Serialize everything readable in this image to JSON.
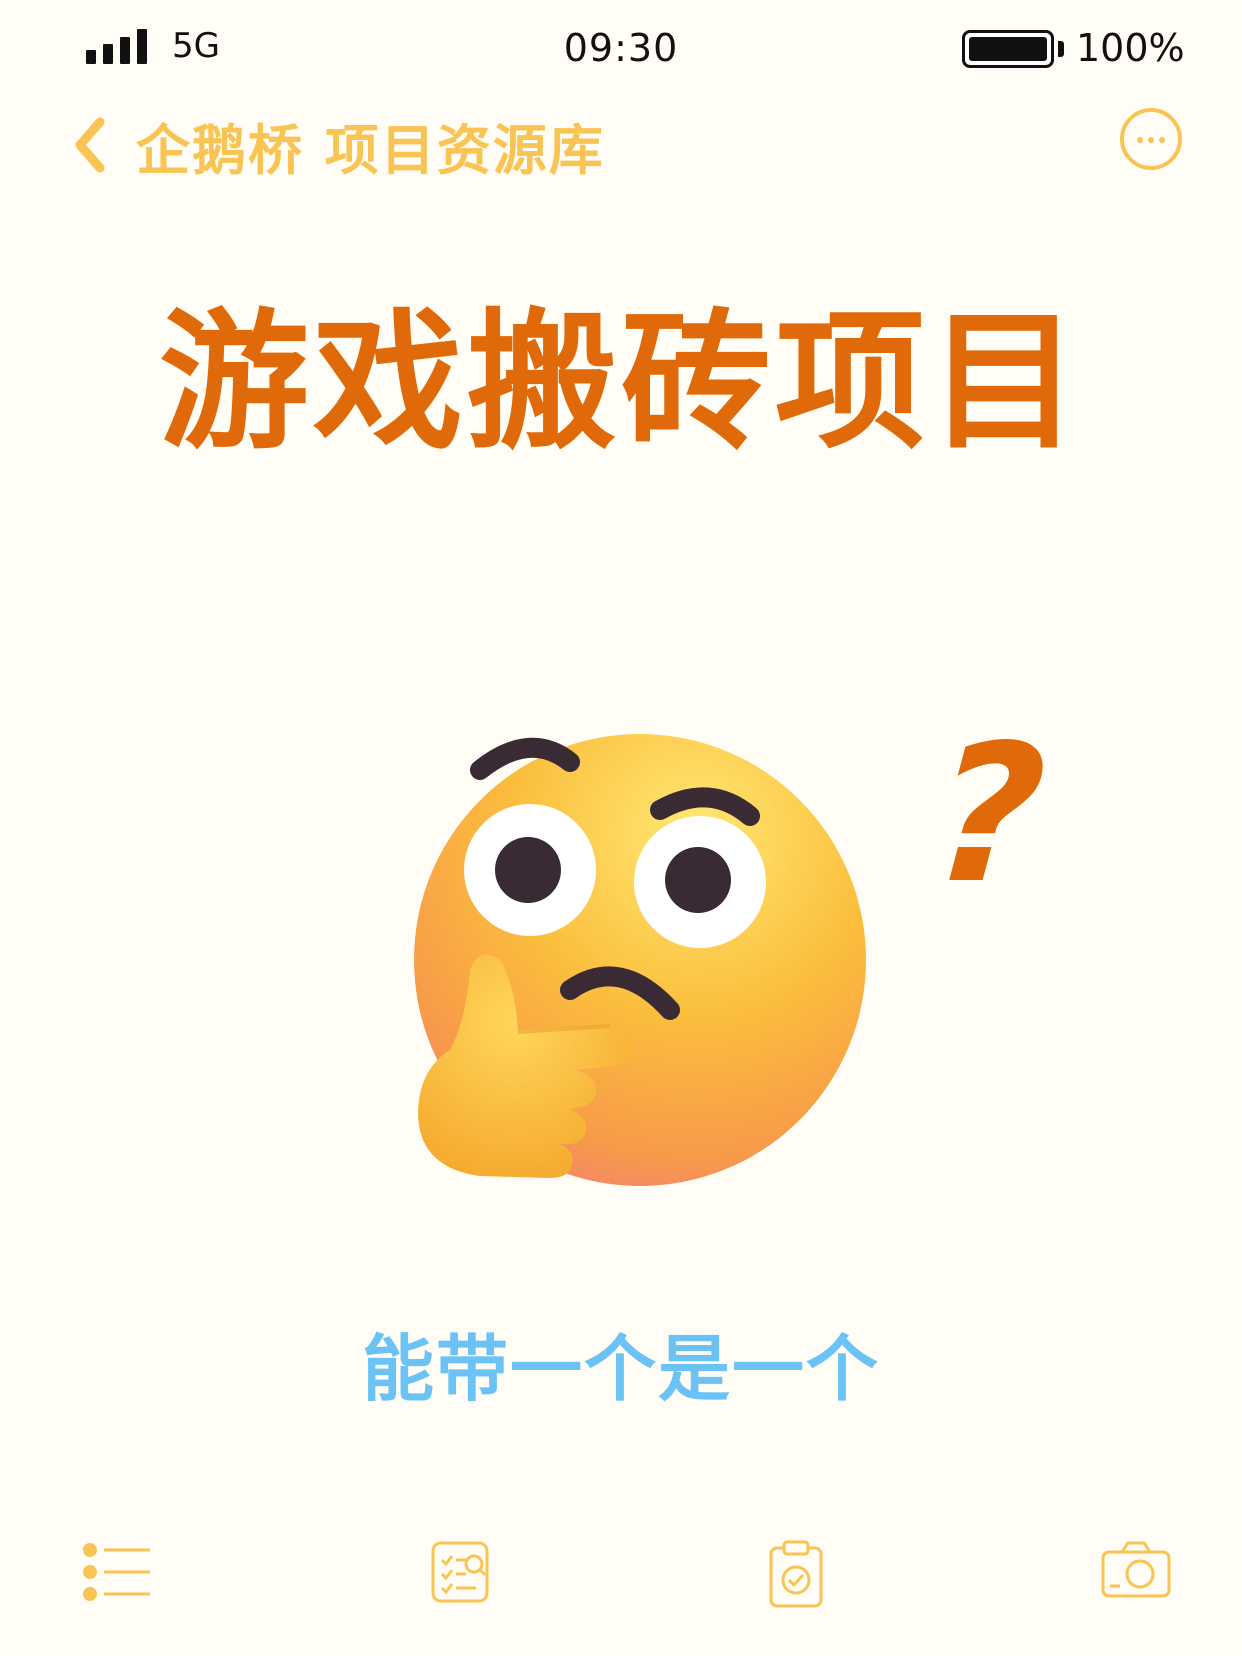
{
  "status_bar": {
    "network": "5G",
    "time": "09:30",
    "battery_percent": "100%",
    "battery_level": 1.0
  },
  "nav": {
    "title": "企鹅桥 项目资源库"
  },
  "content": {
    "headline": "游戏搬砖项目",
    "question_mark": "?",
    "subtitle": "能带一个是一个"
  },
  "icons": {
    "back": "chevron-left-icon",
    "more": "more-horizontal-icon",
    "emoji": "thinking-face-icon",
    "tab_1": "list-icon",
    "tab_2": "checklist-search-icon",
    "tab_3": "clipboard-check-icon",
    "tab_4": "camera-icon"
  },
  "colors": {
    "accent": "#F9C453",
    "headline": "#E06A0A",
    "subtitle": "#6BC2F5",
    "background": "#FFFDF5"
  }
}
